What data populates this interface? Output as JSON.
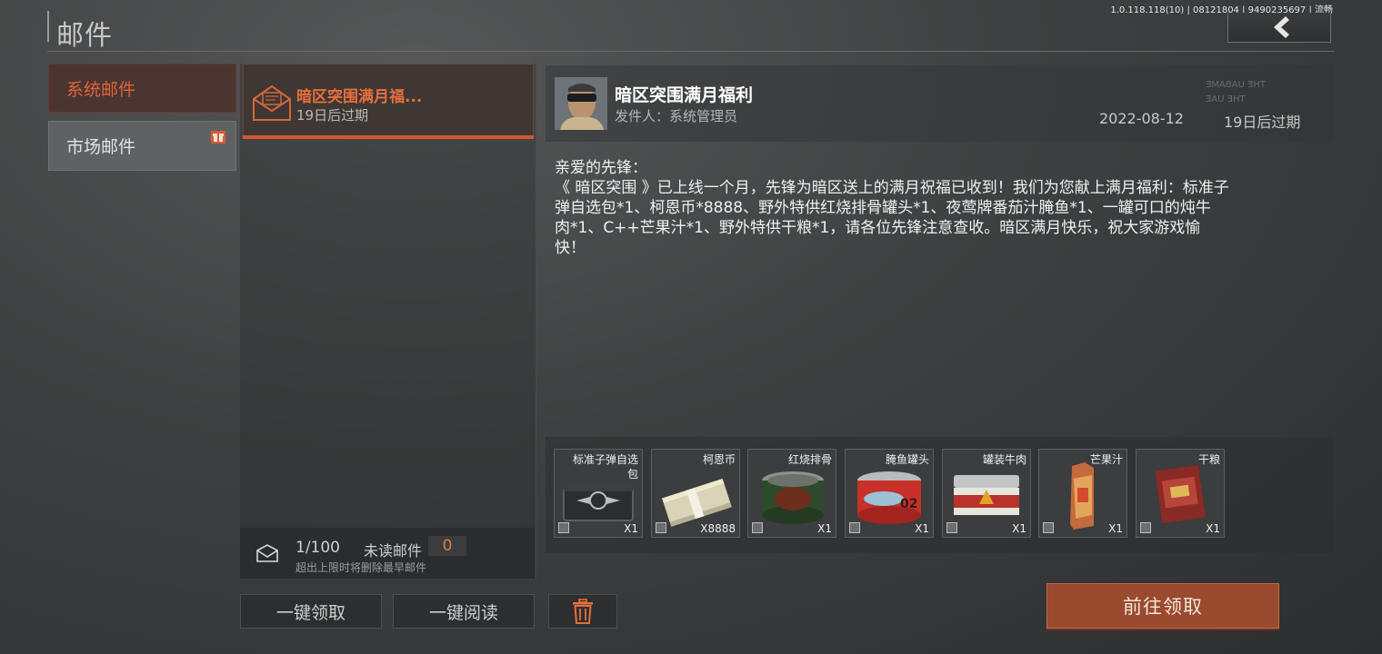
{
  "header": {
    "title": "邮件",
    "version": "1.0.118.118(10) | 08121804 | 9490235697 | 流畅"
  },
  "tabs": [
    {
      "label": "系统邮件",
      "active": true
    },
    {
      "label": "市场邮件",
      "active": false,
      "icon": "gift-icon"
    }
  ],
  "mail_list": {
    "items": [
      {
        "title": "暗区突围满月福...",
        "sub": "19日后过期",
        "icon": "envelope-icon"
      }
    ],
    "footer": {
      "count": "1/100",
      "unread_label": "未读邮件",
      "unread_value": "0",
      "limit_note": "超出上限时将删除最早邮件"
    }
  },
  "buttons": {
    "claim_all": "一键领取",
    "read_all": "一键阅读",
    "go_claim": "前往领取"
  },
  "mail_detail": {
    "title": "暗区突围满月福利",
    "sender": "发件人：系统管理员",
    "date": "2022-08-12",
    "expire": "19日后过期",
    "watermark_line1": "THE UABAME",
    "watermark_line2": "THE UAE",
    "body_lines": [
      "亲爱的先锋：",
      "《 暗区突围 》已上线一个月，先锋为暗区送上的满月祝福已收到！我们为您献上满月福利：标准子",
      "弹自选包*1、柯恩币*8888、野外特供红烧排骨罐头*1、夜莺牌番茄汁腌鱼*1、一罐可口的炖牛",
      "肉*1、C++芒果汁*1、野外特供干粮*1，请各位先锋注意查收。暗区满月快乐，祝大家游戏愉",
      "快！"
    ]
  },
  "rewards": [
    {
      "name": "标准子弹自选包",
      "qty": "X1",
      "icon": "ammo-box-icon"
    },
    {
      "name": "柯恩币",
      "qty": "X8888",
      "icon": "cash-stack-icon"
    },
    {
      "name": "红烧排骨",
      "qty": "X1",
      "icon": "canned-ribs-icon"
    },
    {
      "name": "腌鱼罐头",
      "qty": "X1",
      "icon": "canned-fish-icon"
    },
    {
      "name": "罐装牛肉",
      "qty": "X1",
      "icon": "canned-beef-icon"
    },
    {
      "name": "芒果汁",
      "qty": "X1",
      "icon": "juice-carton-icon"
    },
    {
      "name": "干粮",
      "qty": "X1",
      "icon": "ration-pack-icon"
    }
  ],
  "colors": {
    "accent": "#e0643a",
    "button": "#9a4a2e"
  }
}
